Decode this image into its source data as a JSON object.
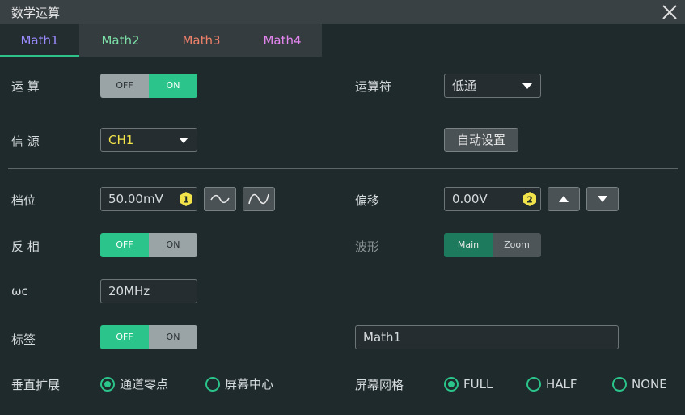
{
  "window": {
    "title": "数学运算"
  },
  "tabs": [
    {
      "label": "Math1",
      "color": "#9b8cff"
    },
    {
      "label": "Math2",
      "color": "#7de0a8"
    },
    {
      "label": "Math3",
      "color": "#f0826a"
    },
    {
      "label": "Math4",
      "color": "#e486f0"
    }
  ],
  "active_tab": "Math1",
  "operation": {
    "label": "运 算",
    "off": "OFF",
    "on": "ON",
    "state": "ON"
  },
  "operator": {
    "label": "运算符",
    "value": "低通"
  },
  "source": {
    "label": "信 源",
    "value": "CH1",
    "value_color": "#f2e34b"
  },
  "auto_set": {
    "label": "自动设置"
  },
  "scale": {
    "label": "档位",
    "value": "50.00mV",
    "knob": "1"
  },
  "offset": {
    "label": "偏移",
    "value": "0.00V",
    "knob": "2"
  },
  "invert": {
    "label": "反 相",
    "off": "OFF",
    "on": "ON",
    "state": "OFF"
  },
  "waveform": {
    "label": "波形",
    "main": "Main",
    "zoom": "Zoom",
    "state": "Main"
  },
  "wc": {
    "label": "ωc",
    "value": "20MHz"
  },
  "tag": {
    "label": "标签",
    "off": "OFF",
    "on": "ON",
    "state": "OFF",
    "value": "Math1"
  },
  "vertical_expand": {
    "label": "垂直扩展",
    "options": [
      "通道零点",
      "屏幕中心"
    ],
    "selected": "通道零点"
  },
  "screen_grid": {
    "label": "屏幕网格",
    "options": [
      "FULL",
      "HALF",
      "NONE"
    ],
    "selected": "FULL"
  },
  "colors": {
    "accent": "#2bc48a",
    "knob": "#f2e34b"
  }
}
